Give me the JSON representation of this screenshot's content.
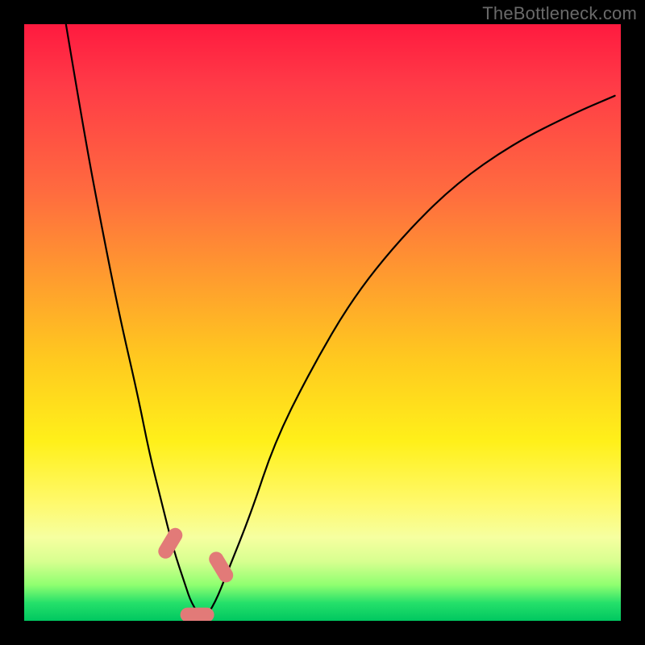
{
  "watermark": "TheBottleneck.com",
  "chart_data": {
    "type": "line",
    "title": "",
    "xlabel": "",
    "ylabel": "",
    "xlim": [
      0,
      100
    ],
    "ylim": [
      0,
      100
    ],
    "grid": false,
    "legend": false,
    "series": [
      {
        "name": "bottleneck-curve",
        "x": [
          7,
          10,
          13,
          16,
          19,
          21,
          23,
          25,
          27,
          28,
          30,
          32,
          34,
          38,
          42,
          48,
          55,
          63,
          72,
          82,
          92,
          99
        ],
        "y": [
          100,
          82,
          66,
          51,
          38,
          28,
          20,
          12,
          6,
          3,
          0,
          3,
          8,
          18,
          30,
          42,
          54,
          64,
          73,
          80,
          85,
          88
        ]
      }
    ],
    "markers": [
      {
        "name": "left-tick",
        "x": 24.5,
        "y": 13
      },
      {
        "name": "valley-dot",
        "x": 29,
        "y": 1
      },
      {
        "name": "right-tick",
        "x": 33,
        "y": 9
      }
    ],
    "gradient_stops": [
      {
        "pos": 0,
        "color": "#ff1a3f"
      },
      {
        "pos": 70,
        "color": "#fff01a"
      },
      {
        "pos": 100,
        "color": "#00c760"
      }
    ]
  }
}
